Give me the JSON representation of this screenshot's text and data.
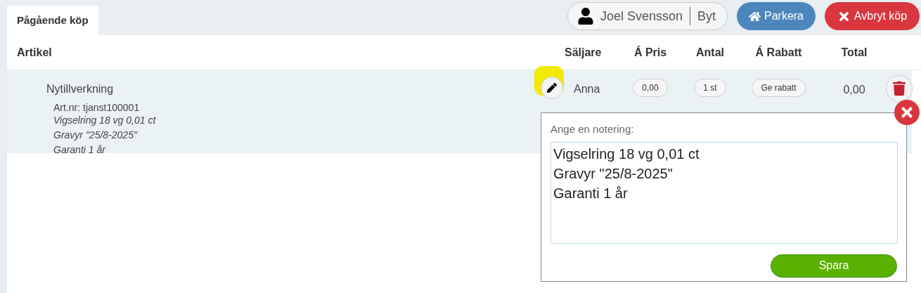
{
  "tabs": [
    {
      "label": "Pågående köp",
      "selected": true
    }
  ],
  "user": {
    "name": "Joel Svensson",
    "switch_label": "Byt"
  },
  "actions": [
    {
      "kind": "park",
      "label": "Parkera"
    },
    {
      "kind": "cancel",
      "label": "Avbryt köp"
    }
  ],
  "table": {
    "columns": [
      "Artikel",
      "Säljare",
      "Á Pris",
      "Antal",
      "Á Rabatt",
      "Total"
    ],
    "rows": [
      {
        "name": "Nytillverkning",
        "article_no": "Art.nr: tjanst100001",
        "notes": [
          "Vigselring 18 vg 0,01 ct",
          "Gravyr \"25/8-2025\"",
          "Garanti 1 år"
        ],
        "seller": "Anna",
        "price": "0,00",
        "quantity": "1 st",
        "discount": "Ge rabatt",
        "total": "0,00"
      }
    ]
  },
  "note_popup": {
    "label": "Ange en notering:",
    "value": "Vigselring 18 vg 0,01 ct\nGravyr \"25/8-2025\"\nGaranti 1 år",
    "save_label": "Spara"
  }
}
